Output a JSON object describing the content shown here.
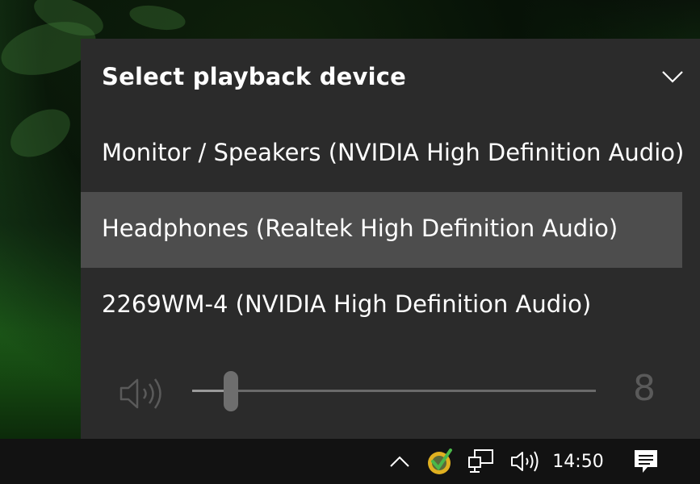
{
  "flyout": {
    "title": "Select playback device",
    "devices": [
      {
        "label": "Monitor / Speakers (NVIDIA High Definition Audio)",
        "selected": false
      },
      {
        "label": "Headphones (Realtek High Definition Audio)",
        "selected": true
      },
      {
        "label": "2269WM-4 (NVIDIA High Definition Audio)",
        "selected": false
      }
    ],
    "volume": {
      "value": "8",
      "level_percent": 8,
      "icon": "speaker-icon"
    }
  },
  "taskbar": {
    "clock": "14:50",
    "tray_icons": [
      "chevron-up-icon",
      "security-shield-icon",
      "network-icon",
      "speaker-icon",
      "notifications-icon"
    ]
  },
  "colors": {
    "panel_bg": "#2b2b2b",
    "selected_row": "#4d4d4d",
    "taskbar_bg": "#121212",
    "text": "#ffffff",
    "dim_text": "#5a5a5a"
  }
}
